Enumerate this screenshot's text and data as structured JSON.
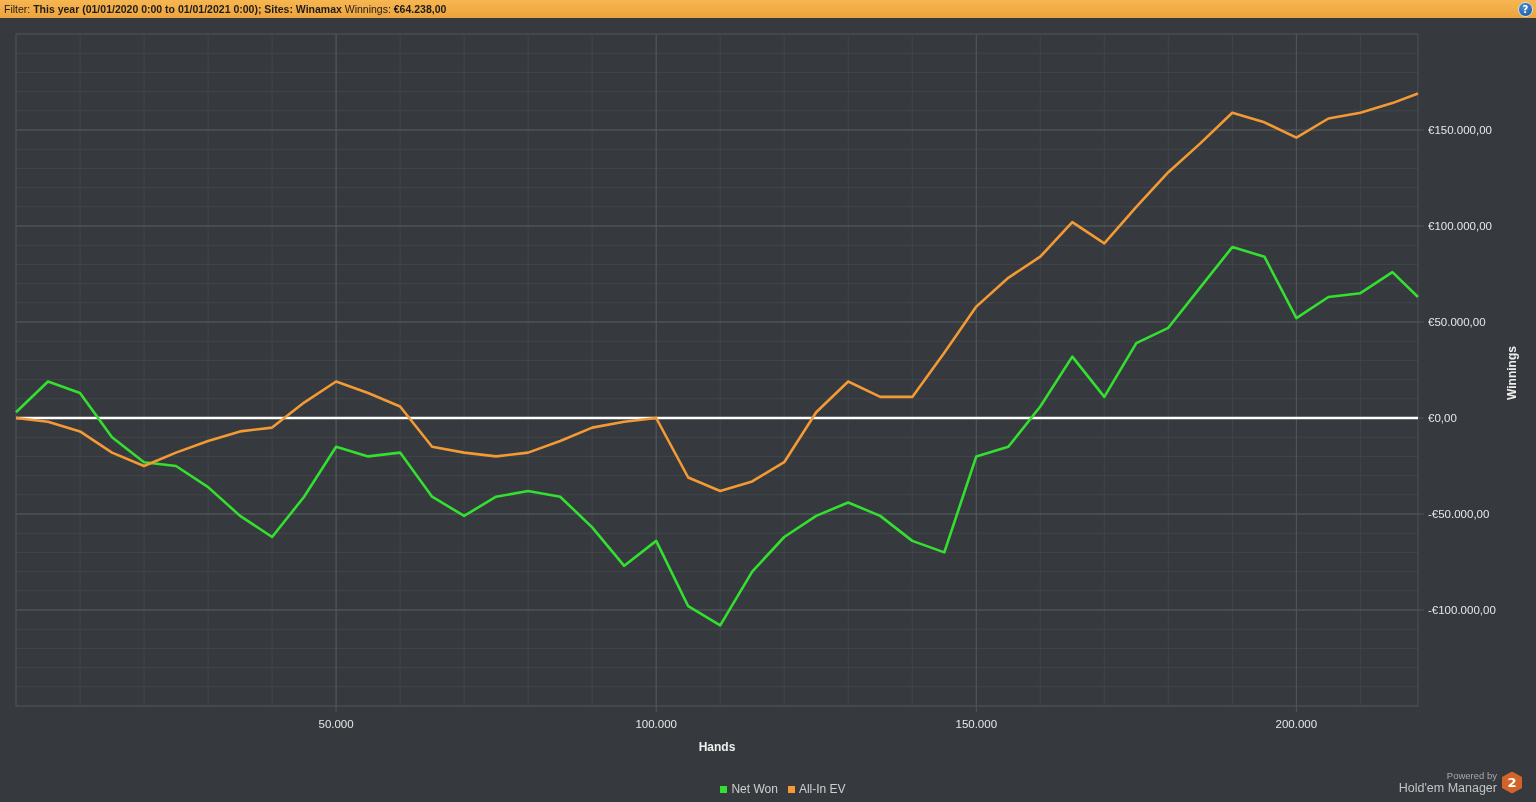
{
  "filter_bar": {
    "text": "Filter: **This year (01/01/2020 0:00 to 01/01/2021 0:00); Sites: Winamax** Winnings: **€64.238,00**",
    "help_button": "?"
  },
  "graph": {
    "chart_data": {
      "type": "line",
      "xlabel": "Hands",
      "ylabel": "Winnings",
      "x": [
        0,
        5000,
        10000,
        15000,
        20000,
        25000,
        30000,
        35000,
        40000,
        45000,
        50000,
        55000,
        60000,
        65000,
        70000,
        75000,
        80000,
        85000,
        90000,
        95000,
        100000,
        105000,
        110000,
        115000,
        120000,
        125000,
        130000,
        135000,
        140000,
        145000,
        150000,
        155000,
        160000,
        165000,
        170000,
        175000,
        180000,
        185000,
        190000,
        195000,
        200000,
        205000,
        210000,
        215000,
        219000
      ],
      "series": [
        {
          "name": "Net Won",
          "color": "#33e02f",
          "values": [
            3000,
            19000,
            13000,
            -10000,
            -23000,
            -25000,
            -36000,
            -51000,
            -62000,
            -41000,
            -15000,
            -20000,
            -18000,
            -41000,
            -51000,
            -41000,
            -38000,
            -41000,
            -57000,
            -77000,
            -64000,
            -98000,
            -108000,
            -80000,
            -62000,
            -51000,
            -44000,
            -51000,
            -64000,
            -70000,
            -20000,
            -15000,
            6000,
            32000,
            11000,
            39000,
            47000,
            68000,
            89000,
            84000,
            52000,
            63000,
            65000,
            76000,
            63000
          ]
        },
        {
          "name": "All-In EV",
          "color": "#f39a35",
          "values": [
            0,
            -2000,
            -7000,
            -18000,
            -25000,
            -18000,
            -12000,
            -7000,
            -5000,
            8000,
            19000,
            13000,
            6000,
            -15000,
            -18000,
            -20000,
            -18000,
            -12000,
            -5000,
            -2000,
            0,
            -31000,
            -38000,
            -33000,
            -23000,
            3000,
            19000,
            11000,
            11000,
            34000,
            58000,
            73000,
            84000,
            102000,
            91000,
            110000,
            128000,
            143000,
            159000,
            154000,
            146000,
            156000,
            159000,
            164000,
            169000
          ]
        }
      ],
      "grid": true,
      "xlim": [
        0,
        219000
      ],
      "ylim": [
        -150000,
        200000
      ],
      "xticks": [
        {
          "value": 50000,
          "label": "50.000"
        },
        {
          "value": 100000,
          "label": "100.000"
        },
        {
          "value": 150000,
          "label": "150.000"
        },
        {
          "value": 200000,
          "label": "200.000"
        }
      ],
      "yticks": [
        {
          "value": -100000,
          "label": "-€100.000,00"
        },
        {
          "value": -50000,
          "label": "-€50.000,00"
        },
        {
          "value": 0,
          "label": "€0,00"
        },
        {
          "value": 50000,
          "label": "€50.000,00"
        },
        {
          "value": 100000,
          "label": "€100.000,00"
        },
        {
          "value": 150000,
          "label": "€150.000,00"
        }
      ]
    }
  },
  "branding": {
    "powered_by": "Powered by",
    "product": "Hold'em Manager",
    "logo_badge": "2"
  }
}
